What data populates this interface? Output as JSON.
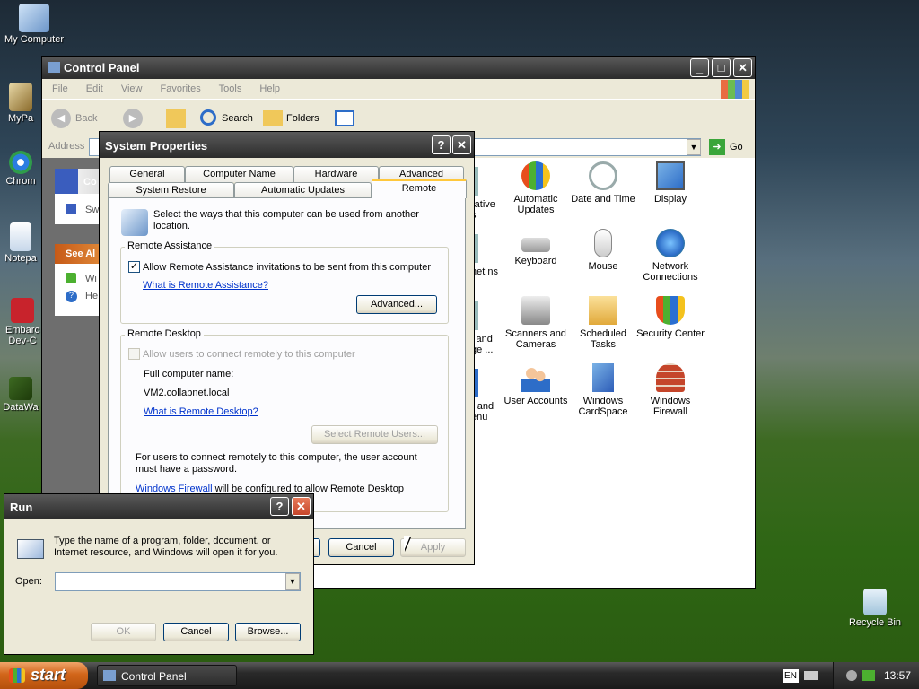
{
  "desktop": {
    "icons": [
      {
        "label": "My Computer"
      },
      {
        "label": "MyPa"
      },
      {
        "label": "Chrom"
      },
      {
        "label": "Notepa"
      },
      {
        "label": "Embarc Dev-C"
      },
      {
        "label": "DataWa"
      },
      {
        "label": "Recycle Bin"
      }
    ]
  },
  "control_panel": {
    "title": "Control Panel",
    "menu": [
      "File",
      "Edit",
      "View",
      "Favorites",
      "Tools",
      "Help"
    ],
    "toolbar": {
      "back": "Back",
      "search": "Search",
      "folders": "Folders"
    },
    "address_label": "Address",
    "go_label": "Go",
    "side_panels": {
      "panel1_title": "Co",
      "panel1_item": "Sw",
      "see_also": "See Al",
      "see_items": [
        "Wi",
        "He"
      ]
    },
    "items": [
      {
        "label": "rative s"
      },
      {
        "label": "Automatic Updates"
      },
      {
        "label": "Date and Time"
      },
      {
        "label": "Display"
      },
      {
        "label": "net ns"
      },
      {
        "label": "Keyboard"
      },
      {
        "label": "Mouse"
      },
      {
        "label": "Network Connections"
      },
      {
        "label": "l and ge ..."
      },
      {
        "label": "Scanners and Cameras"
      },
      {
        "label": "Scheduled Tasks"
      },
      {
        "label": "Security Center"
      },
      {
        "label": "r and enu"
      },
      {
        "label": "User Accounts"
      },
      {
        "label": "Windows CardSpace"
      },
      {
        "label": "Windows Firewall"
      }
    ]
  },
  "system_properties": {
    "title": "System Properties",
    "tabs_row1": [
      "General",
      "Computer Name",
      "Hardware",
      "Advanced"
    ],
    "tabs_row2": [
      "System Restore",
      "Automatic Updates",
      "Remote"
    ],
    "intro": "Select the ways that this computer can be used from another location.",
    "remote_assistance": {
      "group": "Remote Assistance",
      "checkbox": "Allow Remote Assistance invitations to be sent from this computer",
      "link": "What is Remote Assistance?",
      "advanced": "Advanced..."
    },
    "remote_desktop": {
      "group": "Remote Desktop",
      "checkbox": "Allow users to connect remotely to this computer",
      "full_name_label": "Full computer name:",
      "full_name_value": "VM2.collabnet.local",
      "link": "What is Remote Desktop?",
      "select_users": "Select Remote Users...",
      "note": "For users to connect remotely to this computer, the user account must have a password.",
      "firewall_link": "Windows Firewall",
      "firewall_text": "will be configured to allow Remote Desktop"
    },
    "buttons": {
      "cancel": "Cancel",
      "apply": "Apply"
    }
  },
  "run_dialog": {
    "title": "Run",
    "desc": "Type the name of a program, folder, document, or Internet resource, and Windows will open it for you.",
    "open_label": "Open:",
    "open_value": "",
    "ok": "OK",
    "cancel": "Cancel",
    "browse": "Browse..."
  },
  "taskbar": {
    "start": "start",
    "task": "Control Panel",
    "lang": "EN",
    "clock": "13:57"
  }
}
